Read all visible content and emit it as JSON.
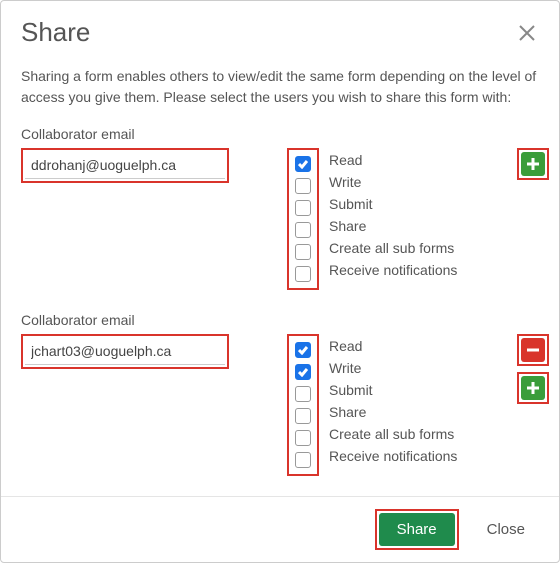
{
  "title": "Share",
  "description": "Sharing a form enables others to view/edit the same form depending on the level of access you give them. Please select the users you wish to share this form with:",
  "collab_label": "Collaborator email",
  "permissions": [
    "Read",
    "Write",
    "Submit",
    "Share",
    "Create all sub forms",
    "Receive notifications"
  ],
  "collaborators": [
    {
      "email": "ddrohanj@uoguelph.ca",
      "checked": [
        true,
        false,
        false,
        false,
        false,
        false
      ],
      "actions": [
        "add"
      ]
    },
    {
      "email": "jchart03@uoguelph.ca",
      "checked": [
        true,
        true,
        false,
        false,
        false,
        false
      ],
      "actions": [
        "remove",
        "add"
      ]
    }
  ],
  "footer": {
    "share": "Share",
    "close": "Close"
  }
}
